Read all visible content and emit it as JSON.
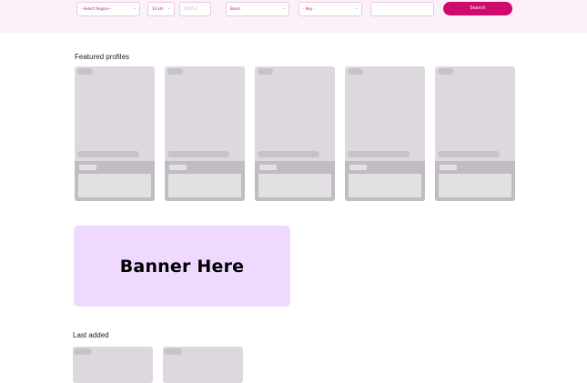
{
  "search_bar": {
    "region_select": "--Select Region--",
    "radius_select": "10 km",
    "zip_placeholder": "ZIP/PLZ",
    "type_select": "Basel",
    "key_select": "- Key -",
    "text_input": "",
    "search_button": "Search"
  },
  "featured": {
    "title": "Featured profiles",
    "card_count": 5
  },
  "banner": {
    "text": "Banner Here"
  },
  "last_added": {
    "title": "Last added",
    "card_count": 2
  }
}
